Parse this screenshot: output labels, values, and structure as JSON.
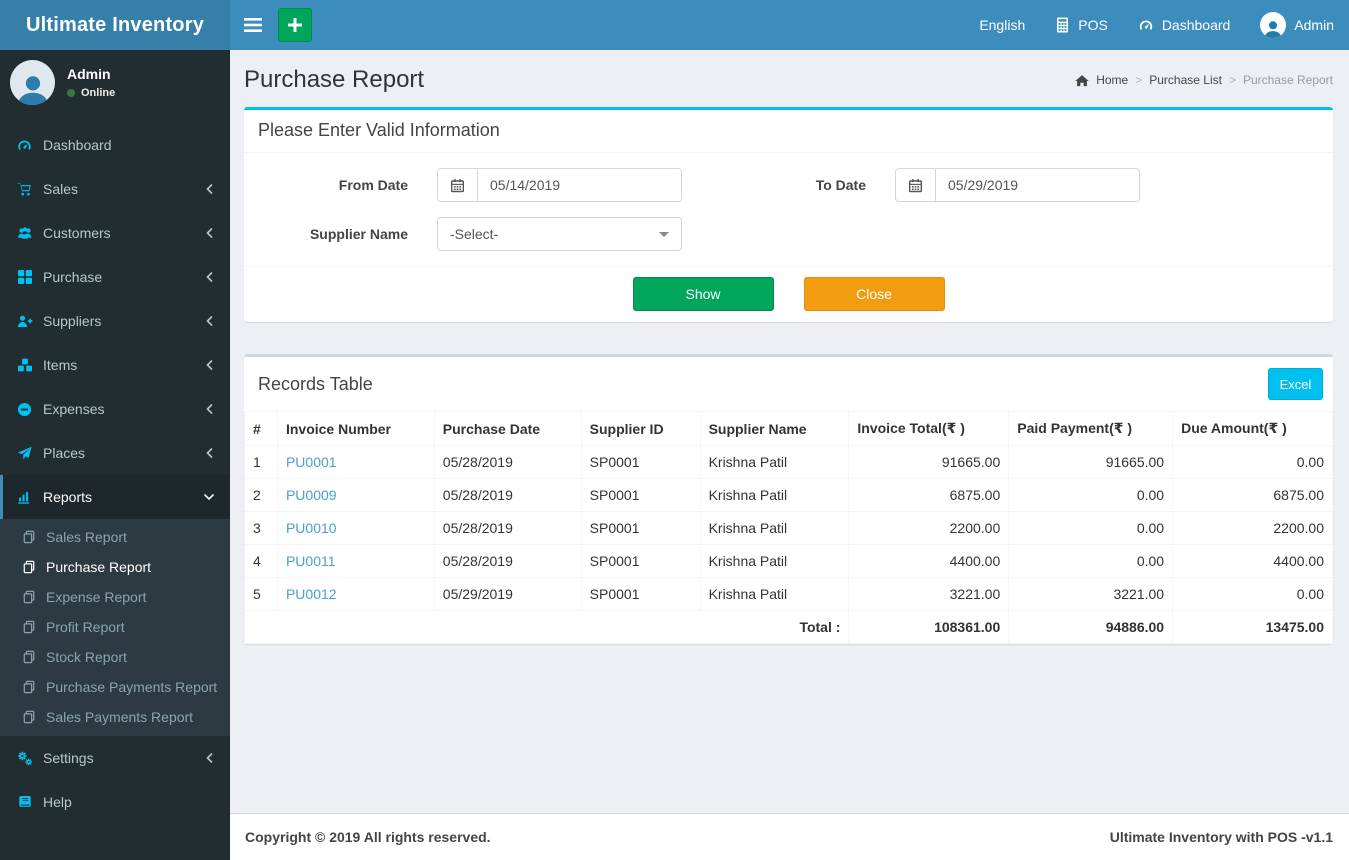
{
  "colors": {
    "navbar": "#3c8dbc",
    "logo_bg": "#367fa9",
    "sidebar_bg": "#222d32",
    "submenu_bg": "#2c3b41",
    "sidebar_icon_accent": "#00c0ef",
    "panel_top_accent": "#00c0ef",
    "show_button": "#00a65a",
    "close_button": "#f39c12",
    "excel_button": "#00c0ef",
    "content_bg": "#ecf0f5",
    "link": "#4a9ed0",
    "online_dot": "#3c763d"
  },
  "brand": "Ultimate Inventory",
  "navbar": {
    "language": "English",
    "pos": "POS",
    "dashboard": "Dashboard",
    "user": "Admin"
  },
  "sidebar": {
    "user_name": "Admin",
    "user_status": "Online",
    "items": [
      {
        "label": "Dashboard"
      },
      {
        "label": "Sales"
      },
      {
        "label": "Customers"
      },
      {
        "label": "Purchase"
      },
      {
        "label": "Suppliers"
      },
      {
        "label": "Items"
      },
      {
        "label": "Expenses"
      },
      {
        "label": "Places"
      },
      {
        "label": "Reports"
      },
      {
        "label": "Settings"
      },
      {
        "label": "Help"
      }
    ],
    "reports_submenu": [
      "Sales Report",
      "Purchase Report",
      "Expense Report",
      "Profit Report",
      "Stock Report",
      "Purchase Payments Report",
      "Sales Payments Report"
    ]
  },
  "page": {
    "title": "Purchase Report",
    "breadcrumb": {
      "home": "Home",
      "parent": "Purchase List",
      "current": "Purchase Report"
    }
  },
  "form": {
    "heading": "Please Enter Valid Information",
    "from_date_label": "From Date",
    "from_date_value": "05/14/2019",
    "to_date_label": "To Date",
    "to_date_value": "05/29/2019",
    "supplier_label": "Supplier Name",
    "supplier_value": "-Select-",
    "show_button": "Show",
    "close_button": "Close"
  },
  "records": {
    "heading": "Records Table",
    "excel_button": "Excel",
    "columns": [
      "#",
      "Invoice Number",
      "Purchase Date",
      "Supplier ID",
      "Supplier Name",
      "Invoice Total(₹ )",
      "Paid Payment(₹ )",
      "Due Amount(₹ )"
    ],
    "rows": [
      {
        "num": "1",
        "invoice": "PU0001",
        "date": "05/28/2019",
        "supplier_id": "SP0001",
        "supplier_name": "Krishna Patil",
        "invoice_total": "91665.00",
        "paid": "91665.00",
        "due": "0.00"
      },
      {
        "num": "2",
        "invoice": "PU0009",
        "date": "05/28/2019",
        "supplier_id": "SP0001",
        "supplier_name": "Krishna Patil",
        "invoice_total": "6875.00",
        "paid": "0.00",
        "due": "6875.00"
      },
      {
        "num": "3",
        "invoice": "PU0010",
        "date": "05/28/2019",
        "supplier_id": "SP0001",
        "supplier_name": "Krishna Patil",
        "invoice_total": "2200.00",
        "paid": "0.00",
        "due": "2200.00"
      },
      {
        "num": "4",
        "invoice": "PU0011",
        "date": "05/28/2019",
        "supplier_id": "SP0001",
        "supplier_name": "Krishna Patil",
        "invoice_total": "4400.00",
        "paid": "0.00",
        "due": "4400.00"
      },
      {
        "num": "5",
        "invoice": "PU0012",
        "date": "05/29/2019",
        "supplier_id": "SP0001",
        "supplier_name": "Krishna Patil",
        "invoice_total": "3221.00",
        "paid": "3221.00",
        "due": "0.00"
      }
    ],
    "total_label": "Total :",
    "total_invoice": "108361.00",
    "total_paid": "94886.00",
    "total_due": "13475.00"
  },
  "footer": {
    "left": "Copyright © 2019 All rights reserved.",
    "right": "Ultimate Inventory with POS -v1.1"
  }
}
